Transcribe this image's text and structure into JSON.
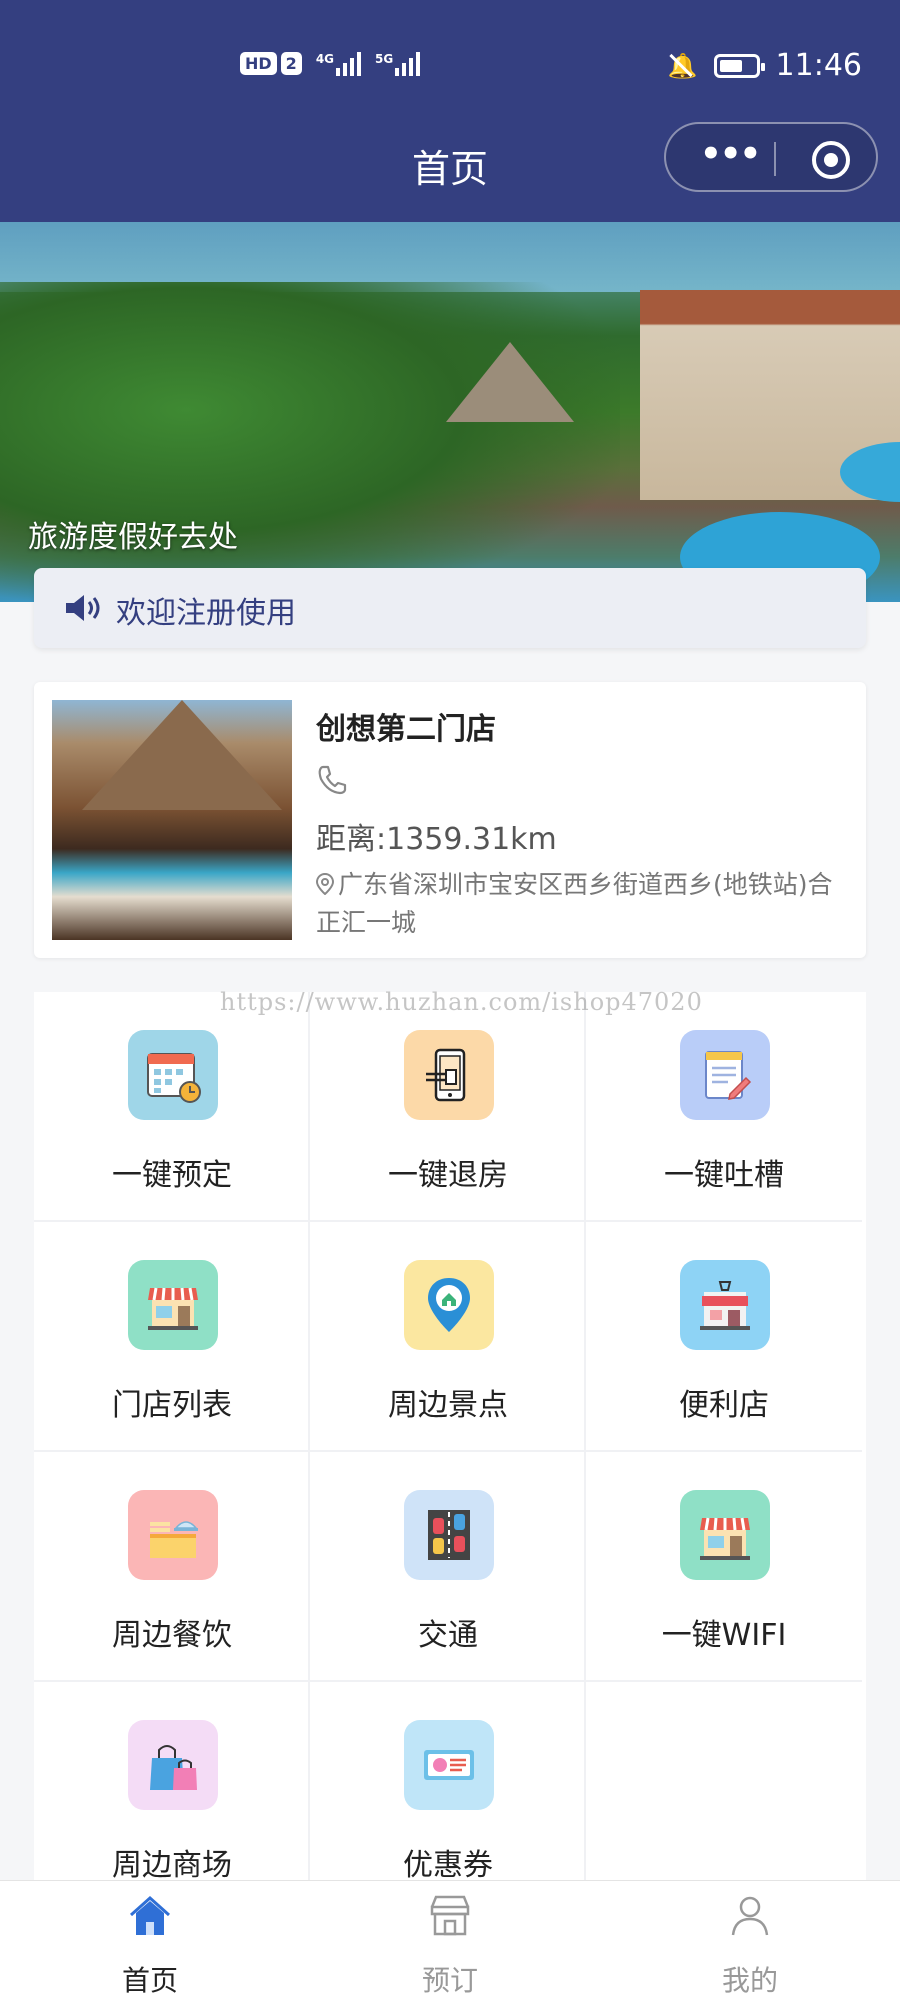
{
  "status_bar": {
    "hd_label": "HD",
    "sim_label": "2",
    "net1": "4G",
    "net2": "5G",
    "time": "11:46"
  },
  "header": {
    "title": "首页",
    "more_label": "•••"
  },
  "banner": {
    "caption": "旅游度假好去处"
  },
  "notice": {
    "text": "欢迎注册使用"
  },
  "store": {
    "name": "创想第二门店",
    "distance": "距离:1359.31km",
    "address": "广东省深圳市宝安区西乡街道西乡(地铁站)合正汇一城"
  },
  "watermark": "https://www.huzhan.com/ishop47020",
  "menu": [
    {
      "label": "一键预定",
      "icon": "calendar-icon",
      "bg": "#9fd6e8"
    },
    {
      "label": "一键退房",
      "icon": "phone-checkout-icon",
      "bg": "#fcd9a8"
    },
    {
      "label": "一键吐槽",
      "icon": "notepad-icon",
      "bg": "#b9cdf8"
    },
    {
      "label": "门店列表",
      "icon": "storefront-icon",
      "bg": "#8fe0c6"
    },
    {
      "label": "周边景点",
      "icon": "map-pin-icon",
      "bg": "#fbe7a0"
    },
    {
      "label": "便利店",
      "icon": "shop-icon",
      "bg": "#8ed3f5"
    },
    {
      "label": "周边餐饮",
      "icon": "food-counter-icon",
      "bg": "#fbb6b6"
    },
    {
      "label": "交通",
      "icon": "traffic-icon",
      "bg": "#cfe3f8"
    },
    {
      "label": "一键WIFI",
      "icon": "storefront-icon",
      "bg": "#8fe0c6"
    },
    {
      "label": "周边商场",
      "icon": "shopping-bag-icon",
      "bg": "#f4dcf6"
    },
    {
      "label": "优惠券",
      "icon": "coupon-icon",
      "bg": "#bfe5f8"
    }
  ],
  "tabbar": {
    "home": "首页",
    "booking": "预订",
    "mine": "我的"
  },
  "colors": {
    "brand": "#343f80",
    "home_tab_active": "#2f6fd6"
  }
}
